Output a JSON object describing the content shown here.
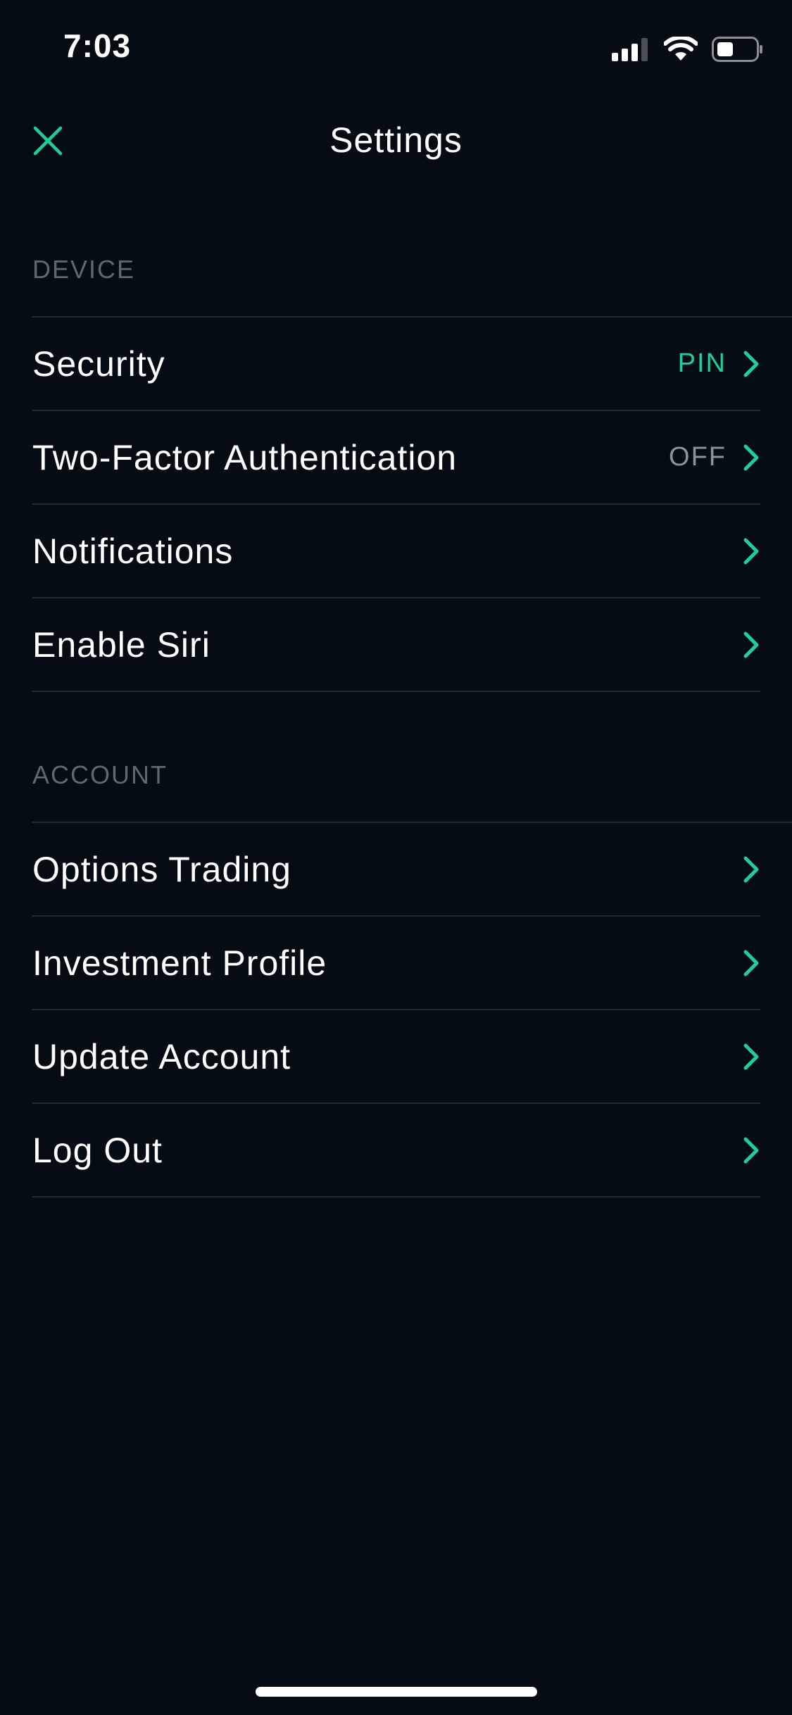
{
  "status_bar": {
    "time": "7:03"
  },
  "header": {
    "title": "Settings"
  },
  "colors": {
    "background": "#060c13",
    "accent": "#21ce99",
    "section_header": "#5d6870",
    "divider": "#1f2a31",
    "muted_value": "#8a949a"
  },
  "sections": {
    "device": {
      "title": "DEVICE",
      "items": [
        {
          "label": "Security",
          "value": "PIN"
        },
        {
          "label": "Two-Factor Authentication",
          "value": "OFF"
        },
        {
          "label": "Notifications"
        },
        {
          "label": "Enable Siri"
        }
      ]
    },
    "account": {
      "title": "ACCOUNT",
      "items": [
        {
          "label": "Options Trading"
        },
        {
          "label": "Investment Profile"
        },
        {
          "label": "Update Account"
        },
        {
          "label": "Log Out"
        }
      ]
    }
  },
  "icons": {
    "close": "close-icon",
    "chevron": "chevron-right-icon",
    "signal": "cellular-signal-icon",
    "wifi": "wifi-icon",
    "battery": "battery-icon"
  }
}
